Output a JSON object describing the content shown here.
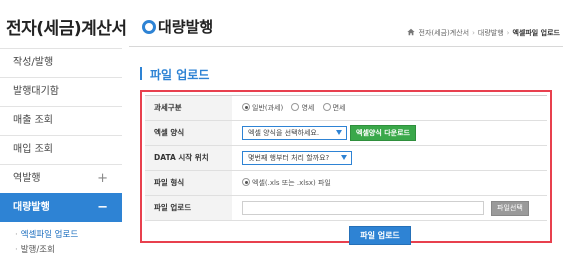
{
  "app": {
    "title": "전자(세금)계산서"
  },
  "sidebar": {
    "items": [
      {
        "label": "작성/발행",
        "plus": ""
      },
      {
        "label": "발행대기함",
        "plus": ""
      },
      {
        "label": "매출 조회",
        "plus": ""
      },
      {
        "label": "매입 조회",
        "plus": ""
      },
      {
        "label": "역발행",
        "plus": "+"
      },
      {
        "label": "대량발행",
        "plus": "−"
      }
    ],
    "subitems": [
      {
        "label": "엑셀파일 업로드"
      },
      {
        "label": "발행/조회"
      }
    ]
  },
  "header": {
    "title": "대량발행"
  },
  "breadcrumb": [
    "전자(세금)계산서",
    "대량발행",
    "엑셀파일 업로드"
  ],
  "section": {
    "title": "파일 업로드"
  },
  "form": {
    "tax_type": {
      "label": "과세구분",
      "options": [
        "일반(과세)",
        "영세",
        "면세"
      ],
      "selected": 0
    },
    "excel_format": {
      "label": "엑셀 양식",
      "placeholder": "엑셀 양식을 선택하세요.",
      "download_label": "엑셀양식 다운로드"
    },
    "data_start": {
      "label": "DATA 시작 위치",
      "placeholder": "몇번째 행부터 처리 할까요?"
    },
    "file_format": {
      "label": "파일 형식",
      "option": "엑셀(.xls 또는 .xlsx) 파일"
    },
    "file_upload": {
      "label": "파일 업로드",
      "value": "",
      "select_label": "파일선택"
    },
    "submit_label": "파일 업로드"
  },
  "colors": {
    "accent": "#2e83d4",
    "highlight": "#e8404e",
    "download": "#3aa84a"
  }
}
